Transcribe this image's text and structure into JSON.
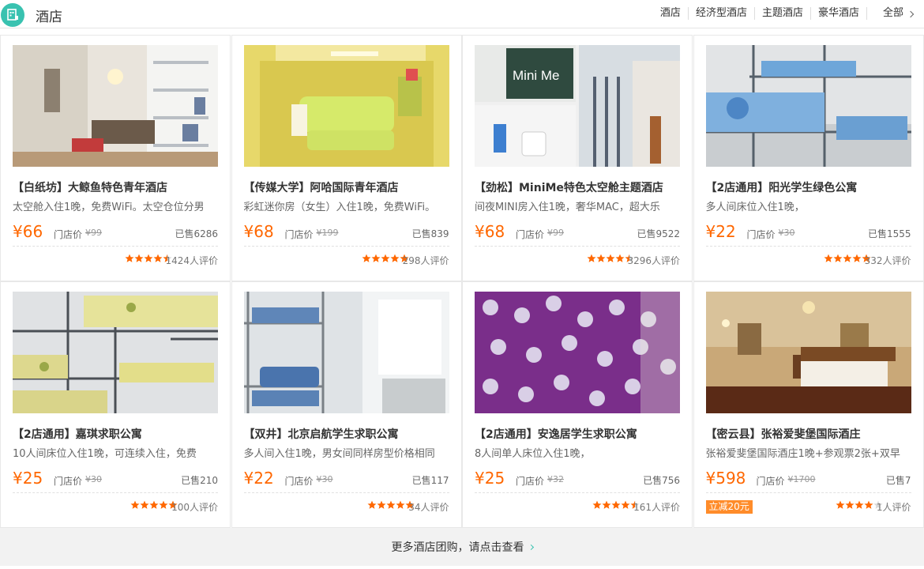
{
  "header": {
    "title": "酒店",
    "logo_icon": "hotel-logo-icon",
    "nav": [
      "酒店",
      "经济型酒店",
      "主题酒店",
      "豪华酒店"
    ],
    "all_label": "全部",
    "accent": "#39c2b0"
  },
  "price_label": "门店价",
  "cards": [
    {
      "name": "【白纸坊】大鲸鱼特色青年酒店",
      "desc": "太空舱入住1晚，免费WiFi。太空仓位分男",
      "price": "¥66",
      "mprice": "¥99",
      "sold": "已售6286",
      "rating": 4.5,
      "reviews": "1424人评价"
    },
    {
      "name": "【传媒大学】阿哈国际青年酒店",
      "desc": "彩虹迷你房（女生）入住1晚，免费WiFi。",
      "price": "¥68",
      "mprice": "¥199",
      "sold": "已售839",
      "rating": 5,
      "reviews": "298人评价"
    },
    {
      "name": "【劲松】MiniMe特色太空舱主题酒店",
      "desc": "间夜MINI房入住1晚，奢华MAC，超大乐",
      "price": "¥68",
      "mprice": "¥99",
      "sold": "已售9522",
      "rating": 4.5,
      "reviews": "3296人评价",
      "img_text": "Mini Me"
    },
    {
      "name": "【2店通用】阳光学生绿色公寓",
      "desc": "多人间床位入住1晚，",
      "price": "¥22",
      "mprice": "¥30",
      "sold": "已售1555",
      "rating": 5,
      "reviews": "332人评价"
    },
    {
      "name": "【2店通用】嘉琪求职公寓",
      "desc": "10人间床位入住1晚，可连续入住，免费",
      "price": "¥25",
      "mprice": "¥30",
      "sold": "已售210",
      "rating": 5,
      "reviews": "100人评价"
    },
    {
      "name": "【双井】北京启航学生求职公寓",
      "desc": "多人间入住1晚，男女间同样房型价格相同",
      "price": "¥22",
      "mprice": "¥30",
      "sold": "已售117",
      "rating": 5,
      "reviews": "34人评价"
    },
    {
      "name": "【2店通用】安逸居学生求职公寓",
      "desc": "8人间单人床位入住1晚，",
      "price": "¥25",
      "mprice": "¥32",
      "sold": "已售756",
      "rating": 4.5,
      "reviews": "161人评价"
    },
    {
      "name": "【密云县】张裕爱斐堡国际酒庄",
      "desc": "张裕爱斐堡国际酒庄1晚+参观票2张+双早",
      "price": "¥598",
      "mprice": "¥1700",
      "sold": "已售7",
      "rating": 4,
      "reviews": "1人评价",
      "badge": "立减20元"
    }
  ],
  "more_label": "更多酒店团购，请点击查看"
}
